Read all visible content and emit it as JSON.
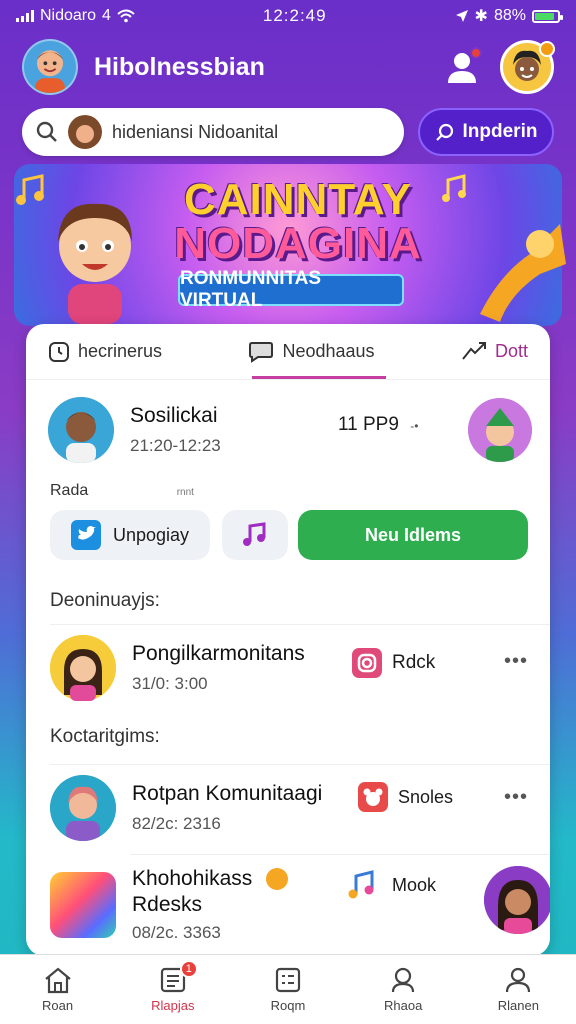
{
  "status_bar": {
    "carrier": "Nidoaro",
    "network": "4",
    "time": "12:2:49",
    "battery": "88%",
    "battery_level": 0.88
  },
  "header": {
    "title": "Hibolnessbian"
  },
  "search": {
    "value": "hideniansі Nidoanital",
    "join_label": "Inpderin"
  },
  "banner": {
    "title_line1": "CAINNTAY",
    "title_line2": "NODAGINA",
    "subtitle": "RONMUNNITAS VIRTUAL"
  },
  "tabs": [
    {
      "label": "hecrinerus",
      "icon": "clock-icon"
    },
    {
      "label": "Neodhaaus",
      "icon": "chat-icon"
    },
    {
      "label": "Dott",
      "icon": "share-icon"
    }
  ],
  "event": {
    "name": "Sosilickai",
    "time": "21:20-12:23",
    "extra": "11 PP9",
    "extra_suffix": "-•",
    "meta_label": "Rada",
    "meta_small": "rnnt"
  },
  "actions": {
    "share_label": "Unpogiay",
    "join_label": "Neu Idlems"
  },
  "sections": {
    "recent": "Deoninuayjs:",
    "contacts": "Koctaritgims:"
  },
  "recent_items": [
    {
      "name": "Pongilkarmonitans",
      "time": "31/0: 3:00",
      "tag": "Rdck"
    }
  ],
  "contact_items": [
    {
      "name": "Rotpan Komunitaagi",
      "time": "82/2c: 2316",
      "tag": "Snoles"
    },
    {
      "name": "Khohohikass",
      "name2": "Rdesks",
      "time": "08/2c. 3363",
      "tag": "Mook"
    }
  ],
  "bottom_nav": [
    {
      "label": "Roan",
      "icon": "home-icon"
    },
    {
      "label": "Rlapjas",
      "icon": "inbox-icon",
      "badge": "1"
    },
    {
      "label": "Roqm",
      "icon": "list-icon"
    },
    {
      "label": "Rhaoa",
      "icon": "people-icon"
    },
    {
      "label": "Rlanen",
      "icon": "profile-icon"
    }
  ],
  "colors": {
    "accent": "#5320c9",
    "primary_green": "#2eae4f",
    "active_nav": "#d4334a"
  }
}
